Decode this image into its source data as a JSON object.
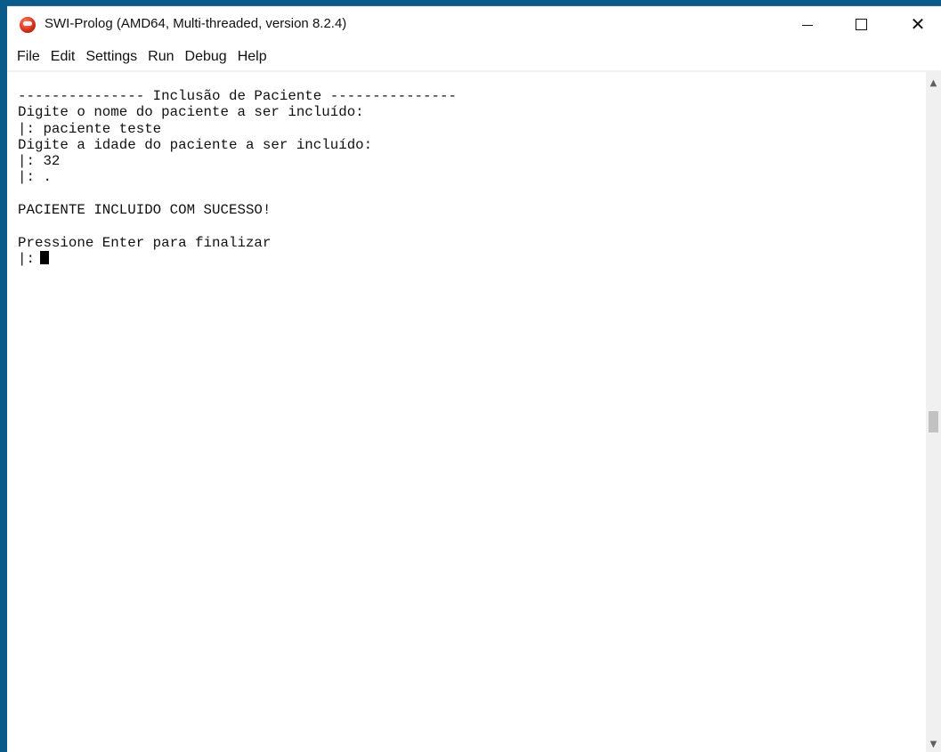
{
  "window": {
    "title": "SWI-Prolog (AMD64, Multi-threaded, version 8.2.4)",
    "icon": "swi-prolog-owl-icon",
    "controls": {
      "minimize": "minimize-icon",
      "maximize": "maximize-icon",
      "close": "close-icon"
    }
  },
  "menu": {
    "items": [
      "File",
      "Edit",
      "Settings",
      "Run",
      "Debug",
      "Help"
    ]
  },
  "console": {
    "lines": [
      "--------------- Inclusão de Paciente ---------------",
      "Digite o nome do paciente a ser incluído:",
      "|: paciente teste",
      "Digite a idade do paciente a ser incluído:",
      "|: 32",
      "|: .",
      "",
      "PACIENTE INCLUIDO COM SUCESSO!",
      "",
      "Pressione Enter para finalizar"
    ],
    "prompt": "|:"
  },
  "colors": {
    "desktop": "#0a5a8a",
    "window_bg": "#ffffff",
    "text": "#111111",
    "scrollbar_bg": "#f0f0f0",
    "scroll_thumb": "#c2c2c2"
  }
}
